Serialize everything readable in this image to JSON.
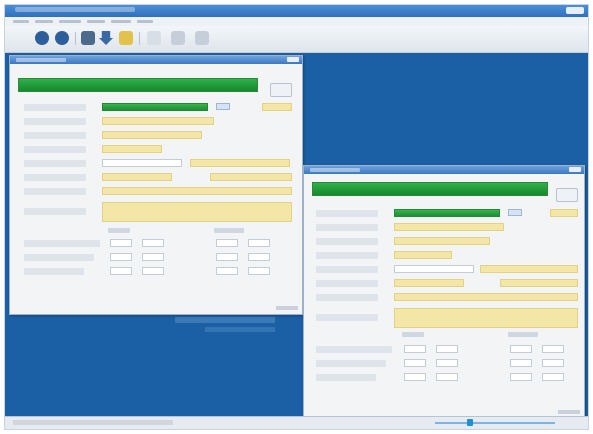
{
  "app": {
    "title": "",
    "menu": [],
    "toolbar": [
      {
        "icon": "back-arrow-icon",
        "color": "#2d5f9c"
      },
      {
        "icon": "forward-arrow-icon",
        "color": "#2d5f9c"
      },
      {
        "icon": "print-icon",
        "color": "#4c6a8c"
      },
      {
        "icon": "down-arrow-icon",
        "color": "#3a6aa6"
      },
      {
        "icon": "folder-icon",
        "color": "#e2c24a"
      },
      {
        "icon": "document-icon",
        "color": "#d8dee6"
      },
      {
        "icon": "tool-icon",
        "color": "#c6cfd9"
      },
      {
        "icon": "tool-icon",
        "color": "#c6cfd9"
      }
    ]
  },
  "windows": [
    {
      "id": "window-1",
      "title": "",
      "banner": "",
      "status": ""
    },
    {
      "id": "window-2",
      "title": "",
      "banner": "",
      "status": ""
    }
  ],
  "colors": {
    "desktop": "#1b5fa4",
    "banner": "#1e9a38",
    "field": "#f4e6a6",
    "panel": "#f2f4f6"
  }
}
